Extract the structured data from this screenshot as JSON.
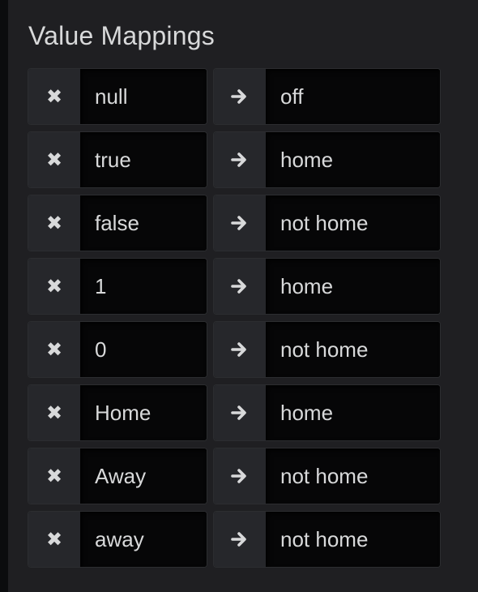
{
  "section": {
    "title": "Value Mappings"
  },
  "mappings": [
    {
      "from": "null",
      "to": "off"
    },
    {
      "from": "true",
      "to": "home"
    },
    {
      "from": "false",
      "to": "not home"
    },
    {
      "from": "1",
      "to": "home"
    },
    {
      "from": "0",
      "to": "not home"
    },
    {
      "from": "Home",
      "to": "home"
    },
    {
      "from": "Away",
      "to": "not home"
    },
    {
      "from": "away",
      "to": "not home"
    }
  ],
  "icons": {
    "remove": "close-icon",
    "arrow": "arrow-right-icon",
    "remove_glyph": "✖"
  },
  "colors": {
    "panel_bg": "#1f1f22",
    "addon_bg": "#26272b",
    "input_bg": "#060607",
    "text": "#d8d9da"
  }
}
